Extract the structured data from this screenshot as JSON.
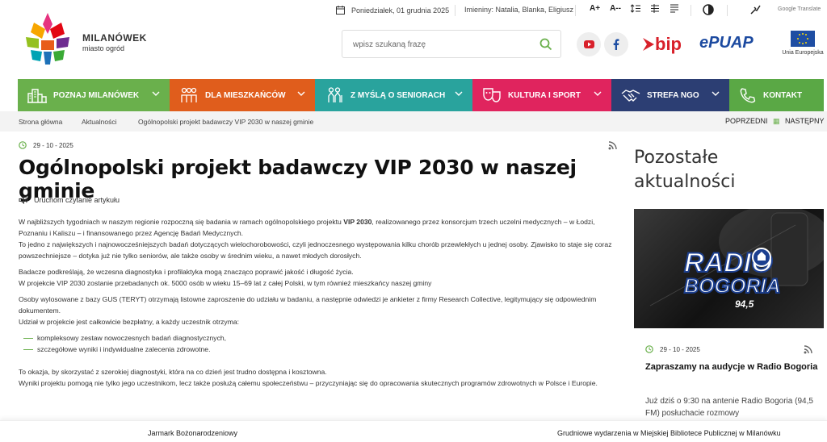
{
  "topbar": {
    "date": "Poniedziałek, 01 grudnia 2025",
    "namedays": "Imieniny: Natalia, Blanka, Eligiusz",
    "font_up": "A+",
    "font_down": "A--",
    "google_translate": "Google Translate"
  },
  "logo": {
    "name": "MILANÓWEK",
    "tagline": "miasto ogród"
  },
  "search": {
    "placeholder": "wpisz szukaną frazę"
  },
  "brand": {
    "bip": "bip",
    "epuap": "ePUAP",
    "eu": "Unia Europejska"
  },
  "colors": {
    "green": "#6ab04c",
    "orange": "#e05d1c",
    "teal": "#29a39d",
    "pink": "#e0245e",
    "navy": "#2c3e73",
    "green2": "#5aa845"
  },
  "nav": [
    {
      "label": "POZNAJ MILANÓWEK",
      "color": "#6ab04c",
      "width": 188,
      "icon": "city-icon"
    },
    {
      "label": "DLA MIESZKAŃCÓW",
      "color": "#e05d1c",
      "width": 180,
      "icon": "people-icon"
    },
    {
      "label": "Z MYŚLĄ O SENIORACH",
      "color": "#29a39d",
      "width": 195,
      "icon": "seniors-icon"
    },
    {
      "label": "KULTURA I SPORT",
      "color": "#e0245e",
      "width": 172,
      "icon": "theatre-icon"
    },
    {
      "label": "STREFA NGO",
      "color": "#2c3e73",
      "width": 146,
      "icon": "handshake-icon"
    },
    {
      "label": "KONTAKT",
      "color": "#5aa845",
      "width": 117,
      "icon": "phone-icon"
    }
  ],
  "breadcrumb": [
    "Strona główna",
    "Aktualności",
    "Ogólnopolski projekt badawczy VIP 2030 w naszej gminie"
  ],
  "pager": {
    "prev": "POPRZEDNI",
    "next": "NASTĘPNY"
  },
  "article": {
    "date": "29 - 10 - 2025",
    "title": "Ogólnopolski projekt badawczy VIP 2030 w naszej gminie",
    "listen": "Uruchom czytanie artykułu",
    "p1a": "W najbliższych tygodniach w naszym regionie rozpoczną się badania w ramach ogólnopolskiego projektu ",
    "p1b": "VIP 2030",
    "p1c": ", realizowanego przez konsorcjum trzech uczelni medycznych – w Łodzi, Poznaniu i Kaliszu – i finansowanego przez Agencję Badań Medycznych.",
    "p2": "To jedno z największych i najnowocześniejszych badań dotyczących wielochorobowości, czyli jednoczesnego występowania kilku chorób przewlekłych u jednej osoby. Zjawisko to staje się coraz powszechniejsze – dotyka już nie tylko seniorów, ale także osoby w średnim wieku, a nawet młodych dorosłych.",
    "p3": "Badacze podkreślają, że wczesna diagnostyka i profilaktyka mogą znacząco poprawić jakość i długość życia.",
    "p4": "W projekcie VIP 2030 zostanie przebadanych ok. 5000 osób w wieku 15–69 lat z całej Polski, w tym również mieszkańcy naszej gminy",
    "p5": "Osoby wylosowane z bazy GUS (TERYT) otrzymają listowne zaproszenie do udziału w badaniu, a następnie odwiedzi je ankieter z firmy Research Collective, legitymujący się odpowiednim dokumentem.",
    "p6": "Udział w projekcie jest całkowicie bezpłatny, a każdy uczestnik otrzyma:",
    "list": [
      "kompleksowy zestaw nowoczesnych badań diagnostycznych,",
      "szczegółowe wyniki i indywidualne zalecenia zdrowotne."
    ],
    "p7": "To okazja, by skorzystać z szerokiej diagnostyki, która na co dzień jest trudno dostępna i kosztowna.",
    "p8": "Wyniki projektu pomogą nie tylko jego uczestnikom, lecz także posłużą całemu społeczeństwu – przyczyniając się do opracowania skutecznych programów zdrowotnych w Polsce i Europie."
  },
  "aside": {
    "title": "Pozostałe aktualności",
    "logo_text1": "RADIO",
    "logo_text2": "BOGORIA",
    "logo_freq": "94,5",
    "date": "29 - 10 - 2025",
    "card_title": "Zapraszamy na audycje w Radio Bogoria",
    "card_text": "Już dziś o 9:30 na antenie Radio Bogoria (94,5 FM) posłuchacie rozmowy"
  },
  "bottom": {
    "left": "Jarmark Bożonarodzeniowy",
    "right": "Grudniowe wydarzenia w Miejskiej Bibliotece Publicznej w Milanówku"
  }
}
